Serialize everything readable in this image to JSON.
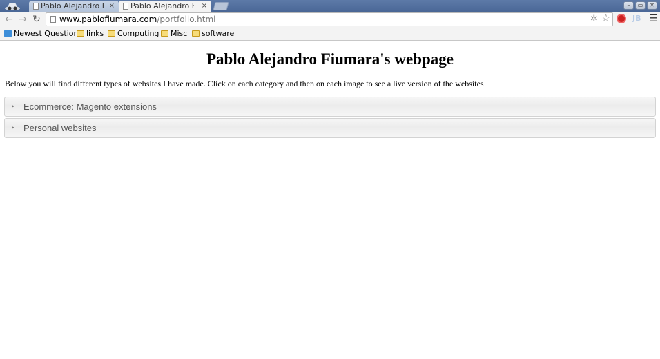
{
  "browser": {
    "tabs": [
      {
        "title": "Pablo Alejandro Fiu",
        "close": "×",
        "active": false
      },
      {
        "title": "Pablo Alejandro Fiu",
        "close": "×",
        "active": true
      }
    ],
    "window_buttons": [
      "–",
      "▭",
      "✕"
    ],
    "url_host": "www.pablofiumara.com",
    "url_path": "/portfolio.html",
    "bookmarks": [
      {
        "label": "Newest Question",
        "icon": "stackoverflow-icon"
      },
      {
        "label": "links",
        "icon": "folder-icon"
      },
      {
        "label": "Computing",
        "icon": "folder-icon"
      },
      {
        "label": "Misc",
        "icon": "folder-icon"
      },
      {
        "label": "software",
        "icon": "folder-icon"
      }
    ]
  },
  "page": {
    "title": "Pablo Alejandro Fiumara's webpage",
    "intro": "Below you will find different types of websites I have made. Click on each category and then on each image to see a live version of the websites",
    "sections": [
      {
        "label": "Ecommerce: Magento extensions",
        "expanded": false
      },
      {
        "label": "Personal websites",
        "expanded": false
      }
    ]
  }
}
